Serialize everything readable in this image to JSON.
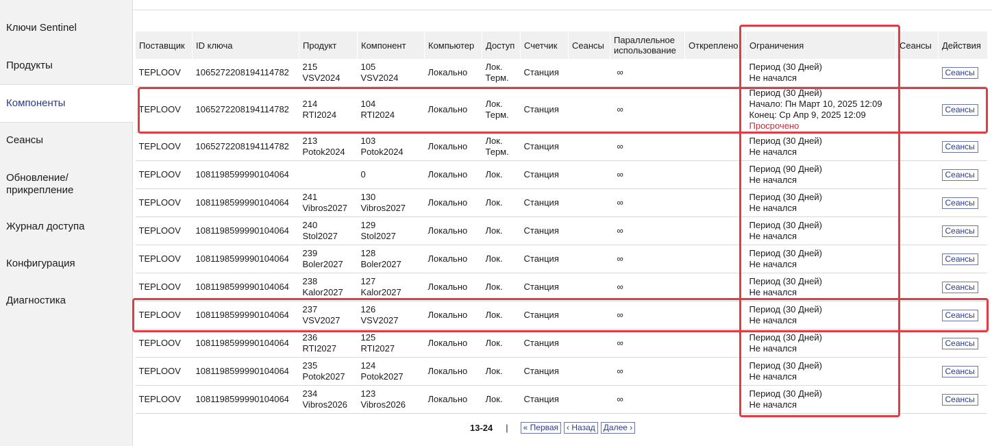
{
  "sidebar": {
    "items": [
      {
        "label": "Ключи Sentinel",
        "active": false
      },
      {
        "label": "Продукты",
        "active": false
      },
      {
        "label": "Компоненты",
        "active": true
      },
      {
        "label": "Сеансы",
        "active": false
      },
      {
        "label": "Обновление/\nприкрепление",
        "active": false
      },
      {
        "label": "Журнал доступа",
        "active": false
      },
      {
        "label": "Конфигурация",
        "active": false
      },
      {
        "label": "Диагностика",
        "active": false
      }
    ]
  },
  "table": {
    "headers": [
      "Поставщик",
      "ID ключа",
      "Продукт",
      "Компонент",
      "Компьютер",
      "Доступ",
      "Счетчик",
      "Сеансы",
      "Параллельное использование",
      "Откреплено",
      "Ограничения",
      "Сеансы",
      "Действия"
    ],
    "button_label": "Сеансы",
    "rows": [
      {
        "vendor": "TEPLOOV",
        "key_id": "1065272208194114782",
        "product": [
          "215",
          "VSV2024"
        ],
        "component": [
          "105",
          "VSV2024"
        ],
        "computer": "Локально",
        "access": [
          "Лок.",
          "Терм."
        ],
        "counter": "Станция",
        "concurrent": "∞",
        "limits": [
          "Период (30 Дней)",
          "Не начался"
        ],
        "expired": ""
      },
      {
        "vendor": "TEPLOOV",
        "key_id": "1065272208194114782",
        "product": [
          "214",
          "RTI2024"
        ],
        "component": [
          "104",
          "RTI2024"
        ],
        "computer": "Локально",
        "access": [
          "Лок.",
          "Терм."
        ],
        "counter": "Станция",
        "concurrent": "∞",
        "limits": [
          "Период (30 Дней)",
          "Начало: Пн Март 10, 2025 12:09",
          "Конец: Ср Апр 9, 2025 12:09"
        ],
        "expired": "Просрочено"
      },
      {
        "vendor": "TEPLOOV",
        "key_id": "1065272208194114782",
        "product": [
          "213",
          "Potok2024"
        ],
        "component": [
          "103",
          "Potok2024"
        ],
        "computer": "Локально",
        "access": [
          "Лок.",
          "Терм."
        ],
        "counter": "Станция",
        "concurrent": "∞",
        "limits": [
          "Период (30 Дней)",
          "Не начался"
        ],
        "expired": ""
      },
      {
        "vendor": "TEPLOOV",
        "key_id": "1081198599990104064",
        "product": [],
        "component": [
          "0"
        ],
        "computer": "Локально",
        "access": [
          "Лок."
        ],
        "counter": "Станция",
        "concurrent": "∞",
        "limits": [
          "Период (90 Дней)",
          "Не начался"
        ],
        "expired": ""
      },
      {
        "vendor": "TEPLOOV",
        "key_id": "1081198599990104064",
        "product": [
          "241",
          "Vibros2027"
        ],
        "component": [
          "130",
          "Vibros2027"
        ],
        "computer": "Локально",
        "access": [
          "Лок."
        ],
        "counter": "Станция",
        "concurrent": "∞",
        "limits": [
          "Период (30 Дней)",
          "Не начался"
        ],
        "expired": ""
      },
      {
        "vendor": "TEPLOOV",
        "key_id": "1081198599990104064",
        "product": [
          "240",
          "Stol2027"
        ],
        "component": [
          "129",
          "Stol2027"
        ],
        "computer": "Локально",
        "access": [
          "Лок."
        ],
        "counter": "Станция",
        "concurrent": "∞",
        "limits": [
          "Период (30 Дней)",
          "Не начался"
        ],
        "expired": ""
      },
      {
        "vendor": "TEPLOOV",
        "key_id": "1081198599990104064",
        "product": [
          "239",
          "Boler2027"
        ],
        "component": [
          "128",
          "Boler2027"
        ],
        "computer": "Локально",
        "access": [
          "Лок."
        ],
        "counter": "Станция",
        "concurrent": "∞",
        "limits": [
          "Период (30 Дней)",
          "Не начался"
        ],
        "expired": ""
      },
      {
        "vendor": "TEPLOOV",
        "key_id": "1081198599990104064",
        "product": [
          "238",
          "Kalor2027"
        ],
        "component": [
          "127",
          "Kalor2027"
        ],
        "computer": "Локально",
        "access": [
          "Лок."
        ],
        "counter": "Станция",
        "concurrent": "∞",
        "limits": [
          "Период (30 Дней)",
          "Не начался"
        ],
        "expired": ""
      },
      {
        "vendor": "TEPLOOV",
        "key_id": "1081198599990104064",
        "product": [
          "237",
          "VSV2027"
        ],
        "component": [
          "126",
          "VSV2027"
        ],
        "computer": "Локально",
        "access": [
          "Лок."
        ],
        "counter": "Станция",
        "concurrent": "∞",
        "limits": [
          "Период (30 Дней)",
          "Не начался"
        ],
        "expired": ""
      },
      {
        "vendor": "TEPLOOV",
        "key_id": "1081198599990104064",
        "product": [
          "236",
          "RTI2027"
        ],
        "component": [
          "125",
          "RTI2027"
        ],
        "computer": "Локально",
        "access": [
          "Лок."
        ],
        "counter": "Станция",
        "concurrent": "∞",
        "limits": [
          "Период (30 Дней)",
          "Не начался"
        ],
        "expired": ""
      },
      {
        "vendor": "TEPLOOV",
        "key_id": "1081198599990104064",
        "product": [
          "235",
          "Potok2027"
        ],
        "component": [
          "124",
          "Potok2027"
        ],
        "computer": "Локально",
        "access": [
          "Лок."
        ],
        "counter": "Станция",
        "concurrent": "∞",
        "limits": [
          "Период (30 Дней)",
          "Не начался"
        ],
        "expired": ""
      },
      {
        "vendor": "TEPLOOV",
        "key_id": "1081198599990104064",
        "product": [
          "234",
          "Vibros2026"
        ],
        "component": [
          "123",
          "Vibros2026"
        ],
        "computer": "Локально",
        "access": [
          "Лок."
        ],
        "counter": "Станция",
        "concurrent": "∞",
        "limits": [
          "Период (30 Дней)",
          "Не начался"
        ],
        "expired": ""
      }
    ]
  },
  "pager": {
    "range": "13-24",
    "separator": "|",
    "first": "« Первая",
    "prev": "‹ Назад",
    "next": "Далее ›"
  },
  "colors": {
    "accent": "#2a3a8c",
    "expired": "#d8242c",
    "highlight": "#e03c44"
  }
}
